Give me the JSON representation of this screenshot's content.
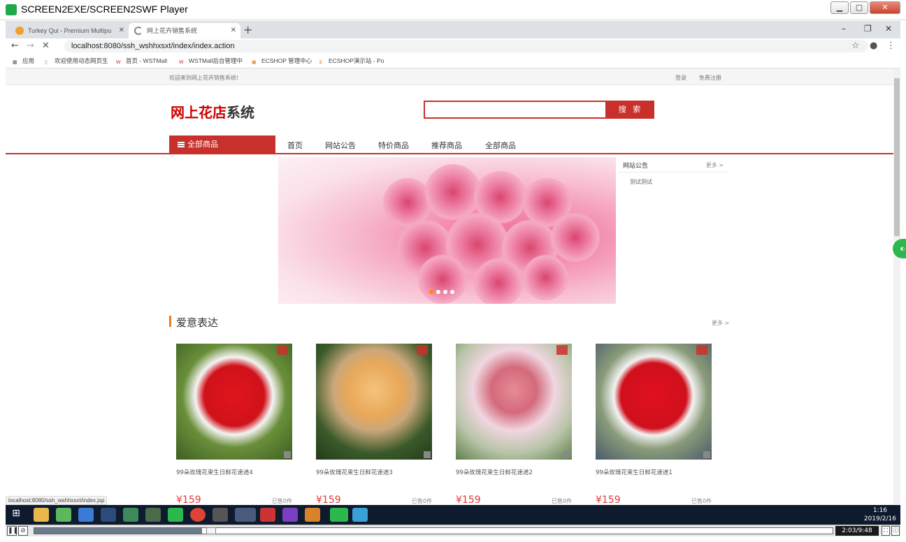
{
  "player": {
    "title": "SCREEN2EXE/SCREEN2SWF Player"
  },
  "browser": {
    "tabs": [
      {
        "label": "Turkey Qui - Premium Multipu"
      },
      {
        "label": "网上花卉销售系统"
      }
    ],
    "url": "localhost:8080/ssh_wshhxsxt/index/index.action",
    "bookmarks": [
      "应用",
      "欢迎使用动态网页生",
      "首页 - WSTMall",
      "WSTMall后台管理中",
      "ECSHOP 管理中心",
      "ECSHOP演示站 - Po"
    ],
    "status_url": "localhost:8080/ssh_wshhxsxt/index.jsp"
  },
  "site": {
    "welcome": "欢迎来到网上花卉销售系统!",
    "login": "登录",
    "register": "免费注册",
    "logo_red": "网上花店",
    "logo_dark": "系统",
    "search": {
      "placeholder": "",
      "button": "搜 索"
    },
    "category_button": "全部商品",
    "nav": [
      "首页",
      "网站公告",
      "特价商品",
      "推荐商品",
      "全部商品"
    ],
    "notice": {
      "title": "网站公告",
      "more": "更多 >",
      "items": [
        "测试测试"
      ]
    },
    "section": {
      "title": "爱意表达",
      "more": "更多 >"
    },
    "products": [
      {
        "name": "99朵玫瑰花束生日鲜花速递4",
        "price": "¥159",
        "sold": "已售0件"
      },
      {
        "name": "99朵玫瑰花束生日鲜花速递3",
        "price": "¥159",
        "sold": "已售0件"
      },
      {
        "name": "99朵玫瑰花束生日鲜花速递2",
        "price": "¥159",
        "sold": "已售0件"
      },
      {
        "name": "99朵玫瑰花束生日鲜花速递1",
        "price": "¥159",
        "sold": "已售0件"
      }
    ]
  },
  "taskbar": {
    "time": "1:16",
    "date": "2019/2/16"
  },
  "playback": {
    "time": "2:03/9:48",
    "progress": 0.21
  },
  "colors": {
    "accent": "#c8312b",
    "section_bar": "#e67e22",
    "price": "#e4393c"
  }
}
